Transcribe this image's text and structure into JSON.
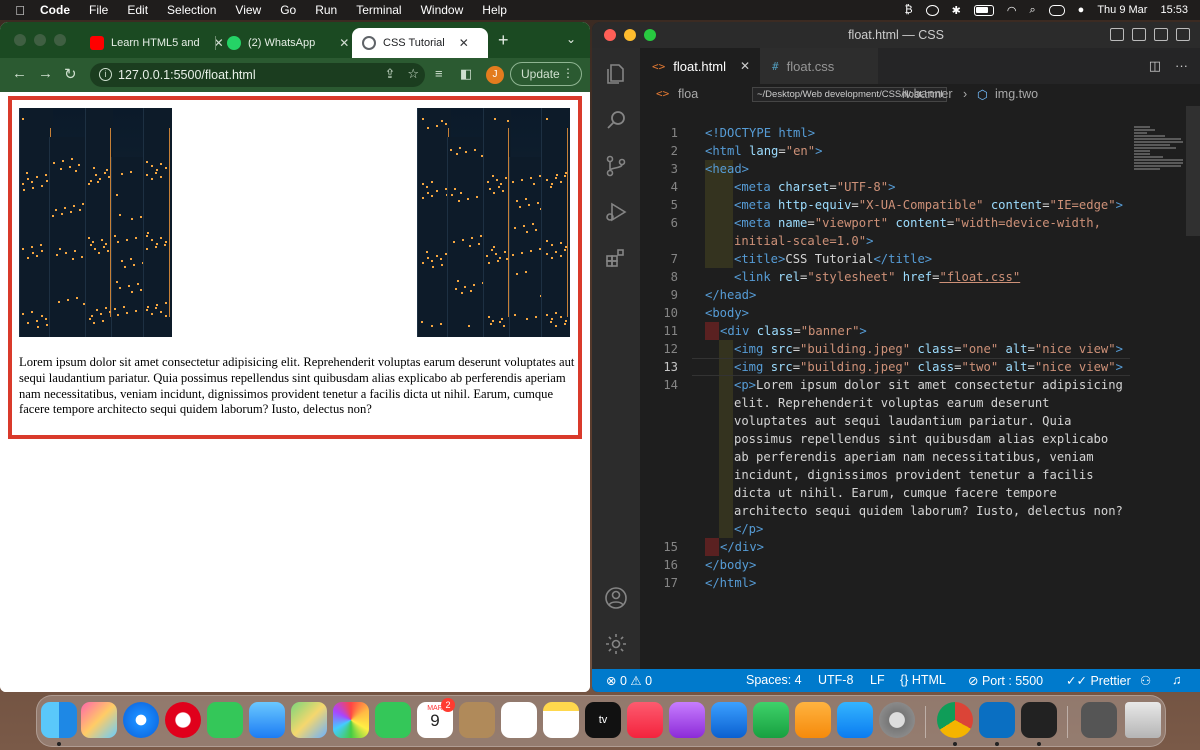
{
  "menubar": {
    "app": "Code",
    "items": [
      "File",
      "Edit",
      "Selection",
      "View",
      "Go",
      "Run",
      "Terminal",
      "Window",
      "Help"
    ],
    "date": "Thu 9 Mar",
    "time": "15:53"
  },
  "browser": {
    "tabs": [
      {
        "label": "Learn HTML5 and",
        "icon": "youtube-icon"
      },
      {
        "label": "(2) WhatsApp",
        "icon": "whatsapp-icon"
      },
      {
        "label": "CSS Tutorial",
        "icon": "globe-icon",
        "active": true
      }
    ],
    "url": "127.0.0.1:5500/float.html",
    "profile_initial": "J",
    "update_label": "Update",
    "page": {
      "paragraph": "Lorem ipsum dolor sit amet consectetur adipisicing elit. Reprehenderit voluptas earum deserunt voluptates aut sequi laudantium pariatur. Quia possimus repellendus sint quibusdam alias explicabo ab perferendis aperiam nam necessitatibus, veniam incidunt, dignissimos provident tenetur a facilis dicta ut nihil. Earum, cumque facere tempore architecto sequi quidem laborum? Iusto, delectus non?",
      "banner_border_color": "#d93a2b"
    }
  },
  "editor": {
    "window_title": "float.html — CSS",
    "tabs": [
      {
        "label": "float.html",
        "icon": "<>",
        "active": true
      },
      {
        "label": "float.css",
        "icon": "#",
        "active": false
      }
    ],
    "breadcrumb": {
      "file": "floa",
      "tooltip": "~/Desktop/Web development/CSS/float.html",
      "node1": "iv.banner",
      "node2": "img.two"
    },
    "current_line": 13,
    "line_numbers": [
      "1",
      "2",
      "3",
      "4",
      "5",
      "6",
      "",
      "7",
      "8",
      "9",
      "10",
      "11",
      "12",
      "13",
      "14",
      "",
      "",
      "",
      "",
      "",
      "",
      "",
      "15",
      "16",
      "17"
    ],
    "status": {
      "errors": "0",
      "warnings": "0",
      "spaces": "Spaces: 4",
      "encoding": "UTF-8",
      "eol": "LF",
      "language": "HTML",
      "port": "Port : 5500",
      "formatter": "Prettier"
    }
  },
  "code_text": {
    "l1": "<!DOCTYPE html>",
    "l2a": "<html ",
    "l2b": "lang",
    "l2c": "=",
    "l2d": "\"en\"",
    "l2e": ">",
    "l3": "<head>",
    "l4a": "<meta ",
    "l4b": "charset",
    "l4c": "=",
    "l4d": "\"UTF-8\"",
    "l4e": ">",
    "l5a": "<meta ",
    "l5b": "http-equiv",
    "l5c": "=",
    "l5d": "\"X-UA-Compatible\"",
    "l5e": " content",
    "l5f": "=",
    "l5g": "\"IE=edge\"",
    "l5h": ">",
    "l6a": "<meta ",
    "l6b": "name",
    "l6c": "=",
    "l6d": "\"viewport\"",
    "l6e": " content",
    "l6f": "=",
    "l6g": "\"width=device-width,",
    "l6w": "initial-scale=1.0\"",
    "l6x": ">",
    "l7a": "<title>",
    "l7b": "CSS Tutorial",
    "l7c": "</title>",
    "l8a": "<link ",
    "l8b": "rel",
    "l8c": "=",
    "l8d": "\"stylesheet\"",
    "l8e": " href",
    "l8f": "=",
    "l8g": "\"float.css\"",
    "l9": "</head>",
    "l10": "<body>",
    "l11a": "<div ",
    "l11b": "class",
    "l11c": "=",
    "l11d": "\"banner\"",
    "l11e": ">",
    "l12a": "<img ",
    "l12b": "src",
    "l12c": "=",
    "l12d": "\"building.jpeg\"",
    "l12e": " class",
    "l12f": "=",
    "l12g": "\"one\"",
    "l12h": " alt",
    "l12i": "=",
    "l12j": "\"nice view\"",
    "l12k": ">",
    "l13a": "<img ",
    "l13b": "src",
    "l13c": "=",
    "l13d": "\"building.jpeg\"",
    "l13e": " class",
    "l13f": "=",
    "l13g": "\"two\"",
    "l13h": " alt",
    "l13i": "=",
    "l13j": "\"nice view\"",
    "l13k": ">",
    "l14a": "<p>",
    "l14b": "Lorem ipsum dolor sit amet consectetur adipisicing",
    "l14c": "elit. Reprehenderit voluptas earum deserunt",
    "l14d": "voluptates aut sequi laudantium pariatur. Quia",
    "l14e": "possimus repellendus sint quibusdam alias explicabo",
    "l14f": "ab perferendis aperiam nam necessitatibus, veniam",
    "l14g": "incidunt, dignissimos provident tenetur a facilis",
    "l14h": "dicta ut nihil. Earum, cumque facere tempore",
    "l14i": "architecto sequi quidem laborum? Iusto, delectus non?",
    "l14j": "</p>",
    "l15": "</div>",
    "l16": "</body>",
    "l17": "</html>"
  },
  "dock": {
    "calendar_month": "MAR",
    "calendar_day": "9",
    "calendar_badge": "2",
    "apps": [
      "Finder",
      "Launchpad",
      "Safari",
      "Opera",
      "Messages",
      "Mail",
      "Maps",
      "Photos",
      "FaceTime",
      "Calendar",
      "Contacts",
      "Reminders",
      "Notes",
      "TV",
      "Music",
      "Podcasts",
      "Keynote",
      "Numbers",
      "Pages",
      "App Store",
      "System Settings",
      "Chrome",
      "VS Code",
      "Figma",
      "Stage",
      "Trash"
    ]
  }
}
